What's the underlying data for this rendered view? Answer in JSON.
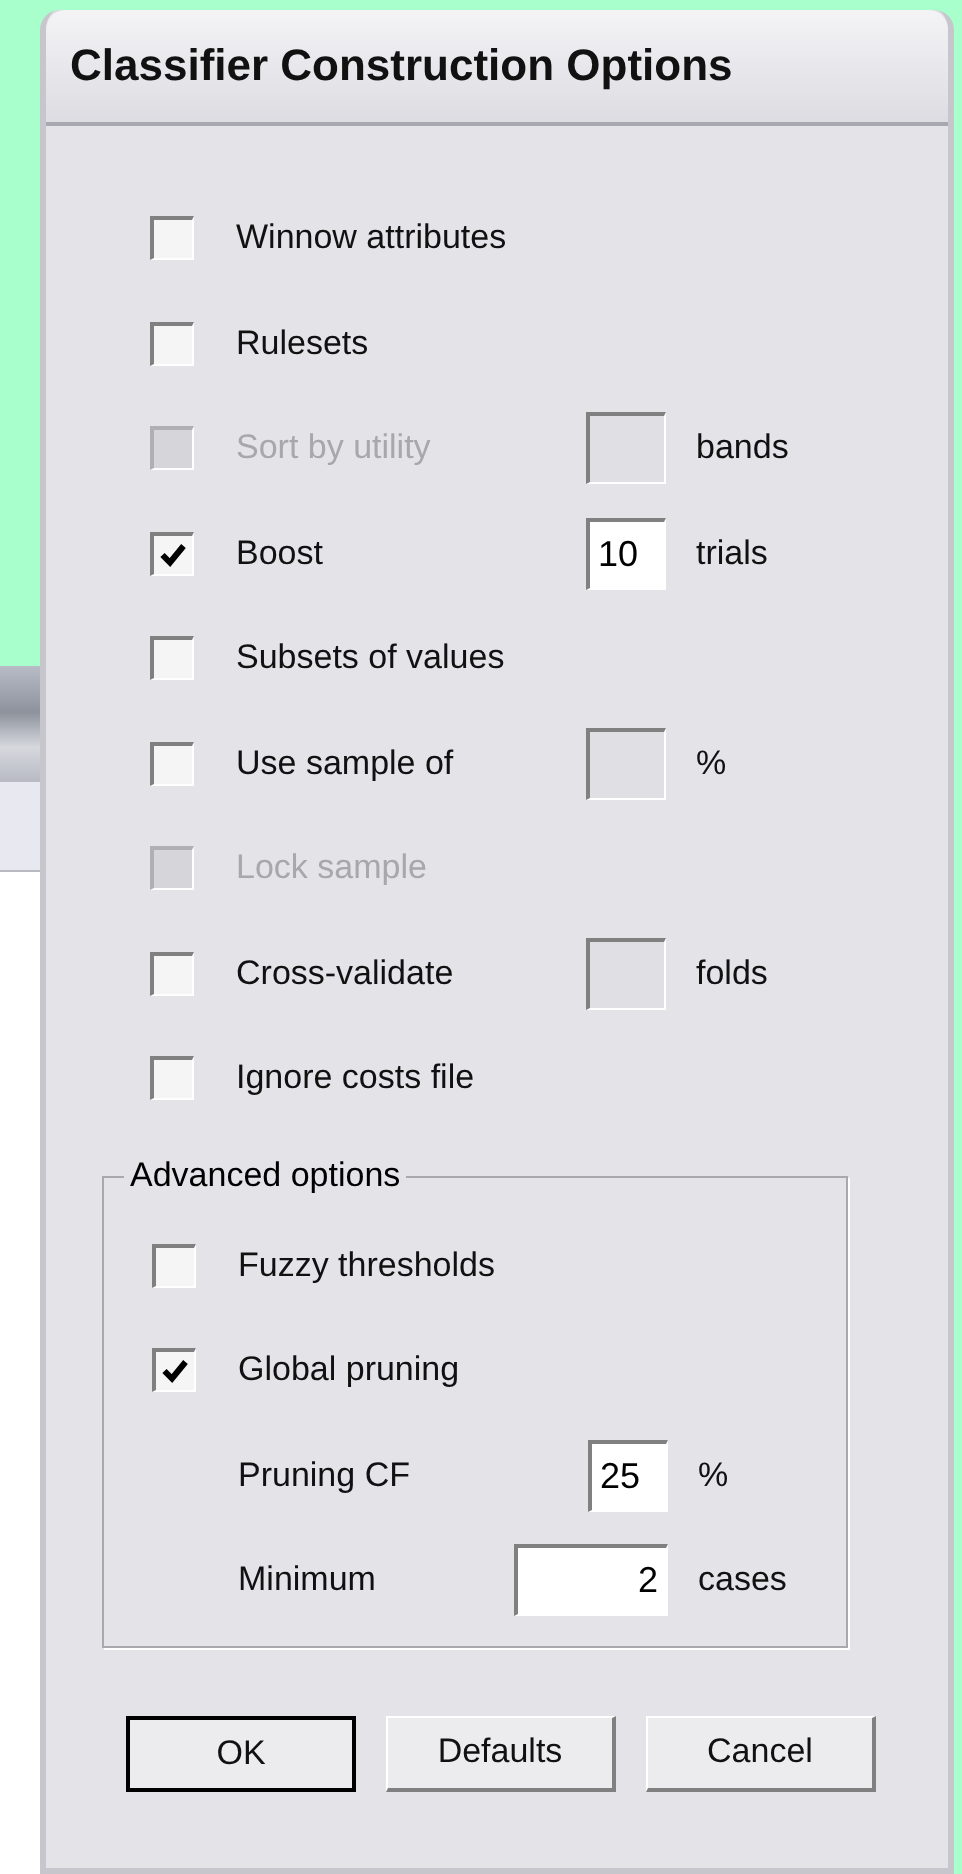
{
  "dialog": {
    "title": "Classifier Construction Options",
    "options": [
      {
        "kind": "checkbox",
        "label": "Winnow attributes",
        "checked": false,
        "disabled": false
      },
      {
        "kind": "checkbox",
        "label": "Rulesets",
        "checked": false,
        "disabled": false
      },
      {
        "kind": "checkbox",
        "label": "Sort by utility",
        "checked": false,
        "disabled": true,
        "field": {
          "disabled": true
        },
        "unit": "bands"
      },
      {
        "kind": "checkbox",
        "label": "Boost",
        "checked": true,
        "disabled": false,
        "field": {
          "value": "10",
          "disabled": false
        },
        "unit": "trials"
      },
      {
        "kind": "checkbox",
        "label": "Subsets of values",
        "checked": false,
        "disabled": false
      },
      {
        "kind": "checkbox",
        "label": "Use sample of",
        "checked": false,
        "disabled": false,
        "field": {
          "disabled": true
        },
        "unit": "%"
      },
      {
        "kind": "checkbox",
        "label": "Lock sample",
        "checked": false,
        "disabled": true
      },
      {
        "kind": "checkbox",
        "label": "Cross-validate",
        "checked": false,
        "disabled": false,
        "field": {
          "disabled": true
        },
        "unit": "folds"
      },
      {
        "kind": "checkbox",
        "label": "Ignore costs file",
        "checked": false,
        "disabled": false
      }
    ],
    "advanced": {
      "legend": "Advanced options",
      "options": [
        {
          "kind": "checkbox",
          "label": "Fuzzy thresholds",
          "checked": false,
          "disabled": false
        },
        {
          "kind": "checkbox",
          "label": "Global pruning",
          "checked": true,
          "disabled": false
        },
        {
          "kind": "number",
          "label": "Pruning CF",
          "field": {
            "value": "25",
            "disabled": false
          },
          "unit": "%"
        },
        {
          "kind": "number",
          "label": "Minimum",
          "field": {
            "value": "2",
            "disabled": false,
            "wide": true
          },
          "unit": "cases"
        }
      ]
    },
    "buttons": [
      {
        "label": "OK",
        "default": true
      },
      {
        "label": "Defaults",
        "default": false
      },
      {
        "label": "Cancel",
        "default": false
      }
    ]
  }
}
